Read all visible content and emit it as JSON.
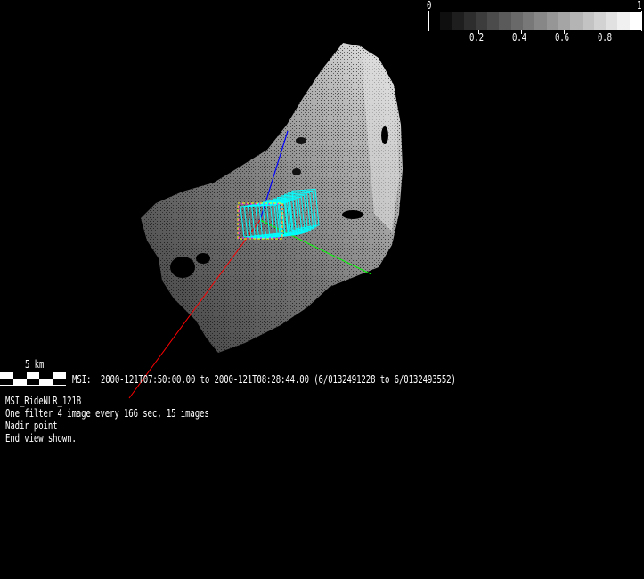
{
  "colorbar": {
    "min_label": "0",
    "max_label": "1",
    "ticks": [
      "0.2",
      "0.4",
      "0.6",
      "0.8"
    ],
    "steps": 17
  },
  "scale_bar": {
    "label": "5 km"
  },
  "msi_line": "MSI:  2000-121T07:50:00.00 to 2000-121T08:28:44.00 (6/0132491228 to 6/0132493552)",
  "info": {
    "name": "MSI_RideNLR_121B",
    "description": "One filter 4 image every 166 sec, 15 images",
    "point": "Nadir point",
    "view": "End view shown."
  },
  "colors": {
    "x_axis": "#ff0000",
    "y_axis": "#00ff00",
    "z_axis": "#0000ff",
    "footprint": "#00ffff",
    "frame_a": "#ffff00",
    "frame_b": "#ff00ff"
  }
}
